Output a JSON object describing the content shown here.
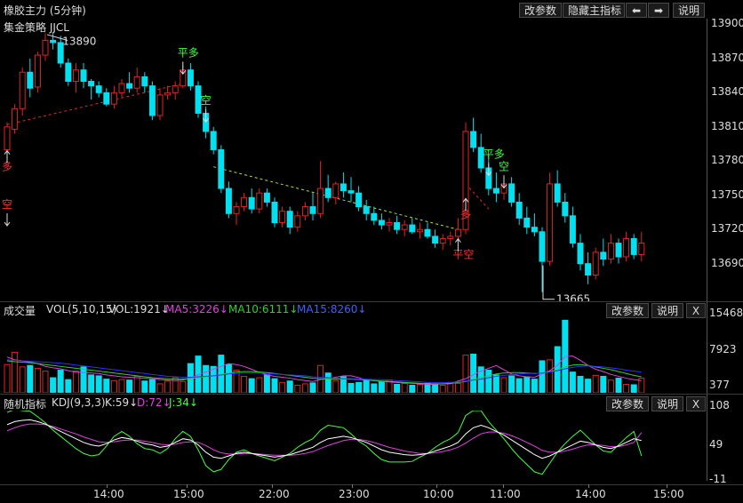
{
  "colors": {
    "up": "#e02424",
    "down": "#00e0f0",
    "ma5": "#e040e0",
    "ma10": "#30d030",
    "ma15": "#3030ff",
    "k": "#ffffff",
    "d": "#e040e0",
    "j": "#40ff40",
    "signal_long": "#ff3030",
    "signal_flat": "#40ff40",
    "grid": "#3a3a3a"
  },
  "title": {
    "instrument": "橡胶主力 (5分钟)",
    "strategy": "集金策略 JJCL"
  },
  "toolbar": {
    "params": "改参数",
    "hide": "隐藏主指标",
    "left_arrow": "⬅",
    "right_arrow": "➡",
    "help": "说明"
  },
  "vol_panel": {
    "name": "成交量",
    "formula": "VOL(5,10,15)",
    "vol": "VOL:1921↓",
    "ma5": "MA5:3226↓",
    "ma10": "MA10:6111↓",
    "ma15": "MA15:8260↓",
    "params": "改参数",
    "help": "说明",
    "close": "X",
    "axis": [
      "15468",
      "7923",
      "377"
    ]
  },
  "kdj_panel": {
    "name": "随机指标",
    "formula": "KDJ(9,3,3)",
    "k": "K:59↓",
    "d": "D:72↓",
    "j": "J:34↓",
    "params": "改参数",
    "help": "说明",
    "close": "X",
    "axis": [
      "108",
      "49",
      "-11"
    ]
  },
  "price_axis": [
    "13900",
    "13870",
    "13840",
    "13810",
    "13780",
    "13750",
    "13720",
    "13690"
  ],
  "time_axis": [
    "14:00",
    "15:00",
    "22:00",
    "23:00",
    "10:00",
    "11:00",
    "14:00",
    "15:00"
  ],
  "annotations": {
    "high": "13890",
    "low": "13665",
    "s1": "多",
    "s1b": "空",
    "s2": "平多",
    "s3": "空",
    "s4": "平空",
    "s5": "多",
    "s6": "平多",
    "s7": "空"
  },
  "chart_data": {
    "type": "candlestick",
    "ylim": [
      13657,
      13905
    ],
    "candles": [
      [
        13790,
        13814,
        13786,
        13810
      ],
      [
        13808,
        13830,
        13804,
        13826
      ],
      [
        13826,
        13862,
        13820,
        13858
      ],
      [
        13858,
        13870,
        13836,
        13844
      ],
      [
        13845,
        13876,
        13840,
        13873
      ],
      [
        13873,
        13892,
        13868,
        13886
      ],
      [
        13886,
        13892,
        13878,
        13884
      ],
      [
        13884,
        13890,
        13862,
        13866
      ],
      [
        13866,
        13870,
        13846,
        13850
      ],
      [
        13850,
        13866,
        13840,
        13860
      ],
      [
        13860,
        13866,
        13844,
        13850
      ],
      [
        13850,
        13852,
        13834,
        13846
      ],
      [
        13846,
        13850,
        13836,
        13840
      ],
      [
        13840,
        13844,
        13828,
        13830
      ],
      [
        13830,
        13846,
        13826,
        13840
      ],
      [
        13840,
        13852,
        13836,
        13848
      ],
      [
        13848,
        13858,
        13840,
        13844
      ],
      [
        13844,
        13862,
        13840,
        13854
      ],
      [
        13854,
        13858,
        13840,
        13846
      ],
      [
        13846,
        13850,
        13816,
        13820
      ],
      [
        13820,
        13844,
        13816,
        13838
      ],
      [
        13838,
        13846,
        13834,
        13840
      ],
      [
        13840,
        13850,
        13834,
        13846
      ],
      [
        13846,
        13864,
        13844,
        13860
      ],
      [
        13860,
        13866,
        13842,
        13846
      ],
      [
        13846,
        13850,
        13818,
        13822
      ],
      [
        13822,
        13828,
        13800,
        13806
      ],
      [
        13806,
        13810,
        13786,
        13790
      ],
      [
        13790,
        13794,
        13752,
        13756
      ],
      [
        13756,
        13762,
        13730,
        13734
      ],
      [
        13734,
        13744,
        13724,
        13740
      ],
      [
        13740,
        13752,
        13736,
        13748
      ],
      [
        13748,
        13756,
        13734,
        13738
      ],
      [
        13738,
        13756,
        13734,
        13752
      ],
      [
        13752,
        13756,
        13740,
        13744
      ],
      [
        13744,
        13748,
        13722,
        13726
      ],
      [
        13726,
        13740,
        13722,
        13736
      ],
      [
        13736,
        13740,
        13716,
        13722
      ],
      [
        13722,
        13736,
        13718,
        13732
      ],
      [
        13732,
        13744,
        13728,
        13740
      ],
      [
        13740,
        13752,
        13728,
        13734
      ],
      [
        13734,
        13780,
        13730,
        13756
      ],
      [
        13756,
        13768,
        13744,
        13748
      ],
      [
        13748,
        13762,
        13742,
        13760
      ],
      [
        13760,
        13770,
        13748,
        13754
      ],
      [
        13754,
        13766,
        13744,
        13752
      ],
      [
        13752,
        13758,
        13736,
        13740
      ],
      [
        13740,
        13746,
        13728,
        13734
      ],
      [
        13734,
        13740,
        13724,
        13728
      ],
      [
        13728,
        13734,
        13720,
        13724
      ],
      [
        13724,
        13730,
        13718,
        13726
      ],
      [
        13726,
        13732,
        13716,
        13720
      ],
      [
        13720,
        13728,
        13714,
        13724
      ],
      [
        13724,
        13730,
        13716,
        13718
      ],
      [
        13718,
        13726,
        13712,
        13720
      ],
      [
        13720,
        13726,
        13712,
        13714
      ],
      [
        13714,
        13720,
        13704,
        13708
      ],
      [
        13708,
        13716,
        13702,
        13712
      ],
      [
        13712,
        13718,
        13706,
        13714
      ],
      [
        13714,
        13730,
        13710,
        13720
      ],
      [
        13720,
        13814,
        13716,
        13806
      ],
      [
        13806,
        13818,
        13788,
        13792
      ],
      [
        13792,
        13804,
        13770,
        13774
      ],
      [
        13774,
        13786,
        13750,
        13756
      ],
      [
        13756,
        13770,
        13744,
        13752
      ],
      [
        13752,
        13768,
        13746,
        13760
      ],
      [
        13760,
        13766,
        13740,
        13744
      ],
      [
        13744,
        13752,
        13724,
        13730
      ],
      [
        13730,
        13740,
        13716,
        13722
      ],
      [
        13722,
        13734,
        13714,
        13718
      ],
      [
        13718,
        13722,
        13665,
        13692
      ],
      [
        13692,
        13770,
        13688,
        13760
      ],
      [
        13760,
        13772,
        13740,
        13744
      ],
      [
        13744,
        13752,
        13726,
        13732
      ],
      [
        13732,
        13740,
        13704,
        13708
      ],
      [
        13708,
        13716,
        13684,
        13690
      ],
      [
        13690,
        13700,
        13672,
        13680
      ],
      [
        13680,
        13704,
        13676,
        13700
      ],
      [
        13700,
        13712,
        13688,
        13694
      ],
      [
        13694,
        13716,
        13690,
        13708
      ],
      [
        13708,
        13712,
        13690,
        13696
      ],
      [
        13696,
        13718,
        13692,
        13712
      ],
      [
        13712,
        13716,
        13694,
        13698
      ],
      [
        13698,
        13718,
        13692,
        13708
      ]
    ],
    "volume": [
      6000,
      8600,
      5500,
      5800,
      5200,
      4600,
      3200,
      4800,
      2800,
      4600,
      5500,
      3800,
      3600,
      2900,
      2600,
      2800,
      2700,
      3500,
      2500,
      2800,
      1900,
      2500,
      3200,
      2400,
      6200,
      7800,
      5800,
      5600,
      8000,
      6000,
      4800,
      3500,
      3000,
      3200,
      3800,
      3000,
      2200,
      2500,
      1600,
      1900,
      2100,
      5800,
      4200,
      2600,
      3400,
      2000,
      2200,
      2600,
      1900,
      2400,
      2700,
      1800,
      2000,
      1600,
      1800,
      2000,
      1900,
      1600,
      2200,
      2000,
      8000,
      8200,
      5500,
      4800,
      3800,
      3200,
      3600,
      3000,
      3400,
      2900,
      6800,
      7000,
      9800,
      15400,
      4400,
      3500,
      2900,
      3700,
      3500,
      2700,
      3100,
      1800,
      1700,
      3100
    ],
    "ma5": [
      7600,
      7000,
      6800,
      6500,
      6200,
      5600,
      5300,
      5100,
      4700,
      4400,
      4300,
      4200,
      4100,
      3800,
      3600,
      3400,
      3300,
      3200,
      3100,
      3000,
      2800,
      2700,
      2600,
      2700,
      3200,
      3800,
      4400,
      5000,
      5600,
      6200,
      6000,
      5600,
      5000,
      4300,
      3800,
      3500,
      3300,
      3100,
      2800,
      2600,
      2400,
      2800,
      3100,
      3300,
      3600,
      3600,
      3200,
      2700,
      2600,
      2400,
      2300,
      2200,
      2100,
      2000,
      1900,
      1800,
      1800,
      1900,
      1900,
      2500,
      3000,
      3800,
      4600,
      5200,
      5800,
      4900,
      4000,
      3600,
      3400,
      3300,
      4000,
      4700,
      5800,
      7700,
      7800,
      6900,
      5800,
      5000,
      4500,
      3900,
      3500,
      3100,
      2800,
      2600
    ],
    "ma10": [
      6800,
      6600,
      6500,
      6400,
      6200,
      6000,
      5800,
      5600,
      5400,
      5200,
      5000,
      4800,
      4600,
      4400,
      4200,
      4000,
      3800,
      3600,
      3400,
      3200,
      3100,
      3000,
      2900,
      2900,
      3000,
      3200,
      3400,
      3600,
      3900,
      4200,
      4400,
      4500,
      4500,
      4400,
      4300,
      4100,
      3900,
      3700,
      3500,
      3300,
      3100,
      3000,
      2900,
      2900,
      2900,
      2900,
      2800,
      2700,
      2600,
      2500,
      2400,
      2300,
      2200,
      2100,
      2000,
      1900,
      1900,
      1900,
      2000,
      2200,
      2400,
      2800,
      3200,
      3600,
      4000,
      4200,
      4300,
      4300,
      4200,
      4100,
      4200,
      4500,
      4900,
      5500,
      5900,
      6000,
      5800,
      5500,
      5200,
      4900,
      4500,
      4100,
      3700,
      3400
    ],
    "ma15": [
      7000,
      6900,
      6800,
      6700,
      6600,
      6500,
      6400,
      6300,
      6100,
      5900,
      5700,
      5500,
      5300,
      5100,
      4900,
      4700,
      4500,
      4300,
      4100,
      3900,
      3700,
      3500,
      3400,
      3300,
      3300,
      3400,
      3500,
      3600,
      3800,
      4000,
      4100,
      4200,
      4200,
      4200,
      4100,
      4000,
      3900,
      3800,
      3700,
      3600,
      3400,
      3300,
      3200,
      3100,
      3000,
      3000,
      2900,
      2900,
      2800,
      2800,
      2700,
      2600,
      2500,
      2400,
      2300,
      2200,
      2200,
      2200,
      2200,
      2300,
      2500,
      2700,
      2900,
      3200,
      3500,
      3700,
      3900,
      4000,
      4100,
      4100,
      4200,
      4400,
      4700,
      5100,
      5400,
      5600,
      5700,
      5600,
      5500,
      5300,
      5100,
      4800,
      4600,
      4400
    ],
    "k": [
      85,
      90,
      92,
      93,
      90,
      86,
      80,
      74,
      68,
      62,
      56,
      52,
      50,
      54,
      60,
      64,
      62,
      58,
      54,
      52,
      48,
      50,
      56,
      62,
      60,
      52,
      40,
      32,
      30,
      34,
      38,
      40,
      38,
      36,
      34,
      32,
      34,
      36,
      40,
      44,
      48,
      56,
      62,
      64,
      66,
      64,
      60,
      56,
      50,
      44,
      40,
      38,
      36,
      35,
      36,
      38,
      42,
      46,
      50,
      56,
      70,
      80,
      84,
      80,
      74,
      68,
      60,
      52,
      44,
      36,
      30,
      34,
      40,
      46,
      52,
      58,
      56,
      52,
      48,
      46,
      50,
      56,
      62,
      59
    ],
    "d": [
      75,
      80,
      84,
      86,
      86,
      85,
      82,
      78,
      74,
      70,
      65,
      61,
      57,
      56,
      57,
      59,
      60,
      60,
      58,
      56,
      53,
      52,
      53,
      56,
      57,
      56,
      51,
      44,
      39,
      37,
      37,
      38,
      38,
      37,
      36,
      35,
      35,
      35,
      36,
      38,
      41,
      46,
      51,
      55,
      59,
      61,
      61,
      59,
      56,
      52,
      48,
      45,
      42,
      40,
      38,
      38,
      39,
      41,
      44,
      48,
      55,
      63,
      70,
      73,
      73,
      71,
      67,
      62,
      56,
      50,
      43,
      40,
      40,
      42,
      45,
      49,
      52,
      52,
      51,
      49,
      49,
      52,
      56,
      72
    ],
    "j": [
      105,
      110,
      108,
      107,
      98,
      88,
      76,
      66,
      56,
      46,
      38,
      34,
      36,
      50,
      66,
      74,
      66,
      54,
      46,
      44,
      38,
      46,
      62,
      74,
      66,
      44,
      18,
      8,
      12,
      28,
      40,
      44,
      38,
      34,
      30,
      26,
      32,
      38,
      48,
      56,
      62,
      76,
      84,
      82,
      80,
      70,
      58,
      50,
      38,
      28,
      24,
      24,
      24,
      25,
      32,
      38,
      48,
      56,
      62,
      72,
      100,
      108,
      108,
      90,
      76,
      62,
      46,
      32,
      20,
      8,
      4,
      22,
      40,
      54,
      66,
      76,
      64,
      52,
      42,
      40,
      52,
      64,
      74,
      34
    ]
  }
}
